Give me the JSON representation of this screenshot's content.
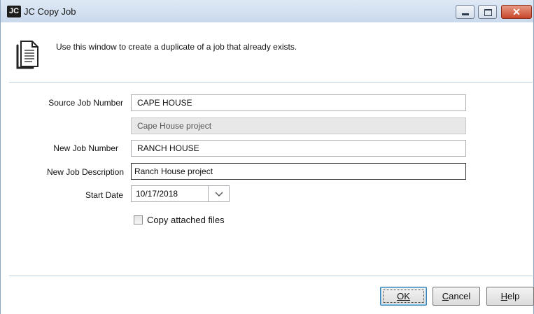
{
  "window": {
    "app_icon_text": "JC",
    "title": "JC Copy Job"
  },
  "header": {
    "intro_text": "Use this window to create a duplicate of a job that already exists."
  },
  "form": {
    "source_job_label": "Source Job Number",
    "source_job_value": "CAPE HOUSE",
    "source_job_desc_value": "Cape House project",
    "new_job_label": "New Job Number",
    "new_job_value": "RANCH HOUSE",
    "new_desc_label": "New Job Description",
    "new_desc_value": "Ranch House project",
    "start_date_label": "Start Date",
    "start_date_value": "10/17/2018",
    "copy_files_label": "Copy attached files",
    "copy_files_checked": false
  },
  "buttons": {
    "ok_label": "OK",
    "cancel_label": "Cancel",
    "help_label": "Help"
  },
  "icons": {
    "app": "jc-app-icon",
    "document": "document-copy-icon",
    "date_dropdown": "chevron-down-icon",
    "minimize": "minimize-icon",
    "maximize": "maximize-icon",
    "close": "close-icon"
  },
  "colors": {
    "titlebar": "#c9d9ec",
    "close_button": "#c7462a",
    "separator": "#bcd3e3"
  }
}
